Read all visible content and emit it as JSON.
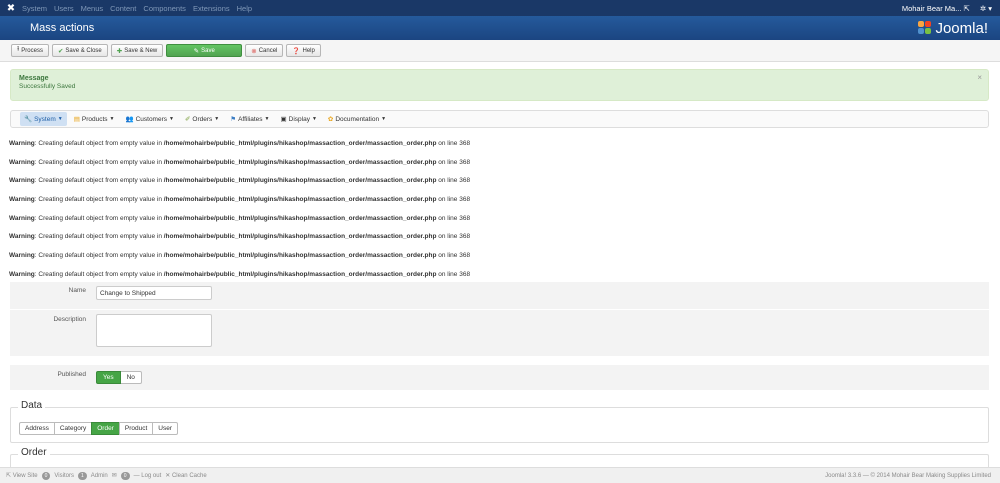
{
  "nav": {
    "menu": [
      "System",
      "Users",
      "Menus",
      "Content",
      "Components",
      "Extensions",
      "Help"
    ],
    "site_name": "Mohair Bear Ma...",
    "settings_caret": "▾"
  },
  "header": {
    "title": "Mass actions",
    "brand": "Joomla!"
  },
  "toolbar": {
    "process": "Process",
    "save_close": "Save & Close",
    "save_new": "Save & New",
    "save": "Save",
    "cancel": "Cancel",
    "help": "Help"
  },
  "message": {
    "heading": "Message",
    "text": "Successfully Saved",
    "close": "×"
  },
  "submenu": [
    "System",
    "Products",
    "Customers",
    "Orders",
    "Affiliates",
    "Display",
    "Documentation"
  ],
  "warnings": {
    "label": "Warning",
    "text": ": Creating default object from empty value in ",
    "path": "/home/mohairbe/public_html/plugins/hikashop/massaction_order/massaction_order.php",
    "suffix": " on line 368"
  },
  "form": {
    "name_label": "Name",
    "name_value": "Change to Shipped",
    "description_label": "Description",
    "description_value": "",
    "published_label": "Published",
    "yes": "Yes",
    "no": "No"
  },
  "data_section": {
    "legend": "Data",
    "tabs": [
      "Address",
      "Category",
      "Order",
      "Product",
      "User"
    ],
    "active_tab": "Order"
  },
  "order_section": {
    "legend": "Order"
  },
  "status": {
    "view_site": "View Site",
    "visitors_count": "0",
    "visitors": "Visitors",
    "admin_count": "1",
    "admin": "Admin",
    "messages_count": "0",
    "logout": "Log out",
    "clean_cache": "Clean Cache",
    "copyright": "Joomla! 3.3.6 — © 2014 Mohair Bear Making Supplies Limited"
  },
  "colors": {
    "navbar": "#1a3867",
    "header": "#1e4d8c",
    "success": "#46a546",
    "message_bg": "#dff0d8"
  }
}
